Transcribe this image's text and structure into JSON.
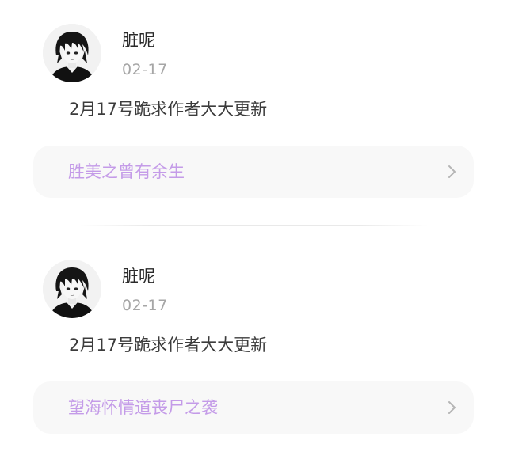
{
  "posts": [
    {
      "author": "脏呢",
      "date": "02-17",
      "comment": "2月17号跪求作者大大更新",
      "book_title": "胜美之曾有余生",
      "avatar_icon": "anime-boy-avatar",
      "chevron_icon": "chevron-right-icon"
    },
    {
      "author": "脏呢",
      "date": "02-17",
      "comment": "2月17号跪求作者大大更新",
      "book_title": "望海怀情道丧尸之袭",
      "avatar_icon": "anime-boy-avatar",
      "chevron_icon": "chevron-right-icon"
    }
  ],
  "colors": {
    "book_title": "#c49be8",
    "card_background": "#f8f8f8",
    "date_text": "#a6a6a6",
    "comment_text": "#3c3c3c",
    "author_text": "#2a2a2a"
  }
}
